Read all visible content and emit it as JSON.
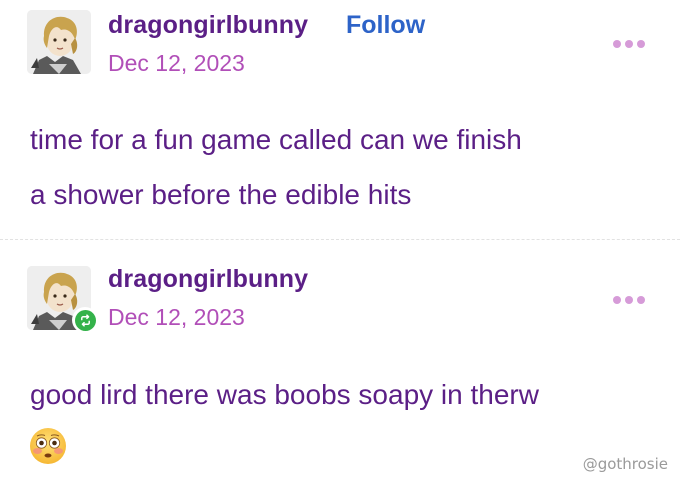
{
  "colors": {
    "username": "#5b1f86",
    "follow": "#2d63c8",
    "date": "#b14fb8",
    "body": "#5b1f86",
    "menu_dots": "#d69bd8",
    "reblog_badge": "#34b24a",
    "watermark": "#9a9a9a"
  },
  "posts": [
    {
      "username": "dragongirlbunny",
      "follow_label": "Follow",
      "date": "Dec 12, 2023",
      "menu_icon": "more-dots-icon",
      "lines": [
        "time for a fun game called can we finish",
        "a shower before the edible hits"
      ]
    },
    {
      "username": "dragongirlbunny",
      "badge_icon": "reblog-icon",
      "date": "Dec 12, 2023",
      "menu_icon": "more-dots-icon",
      "lines": [
        "good lird there was boobs soapy in therw"
      ],
      "emoji": "flushed-face-emoji"
    }
  ],
  "watermark": "@gothrosie"
}
